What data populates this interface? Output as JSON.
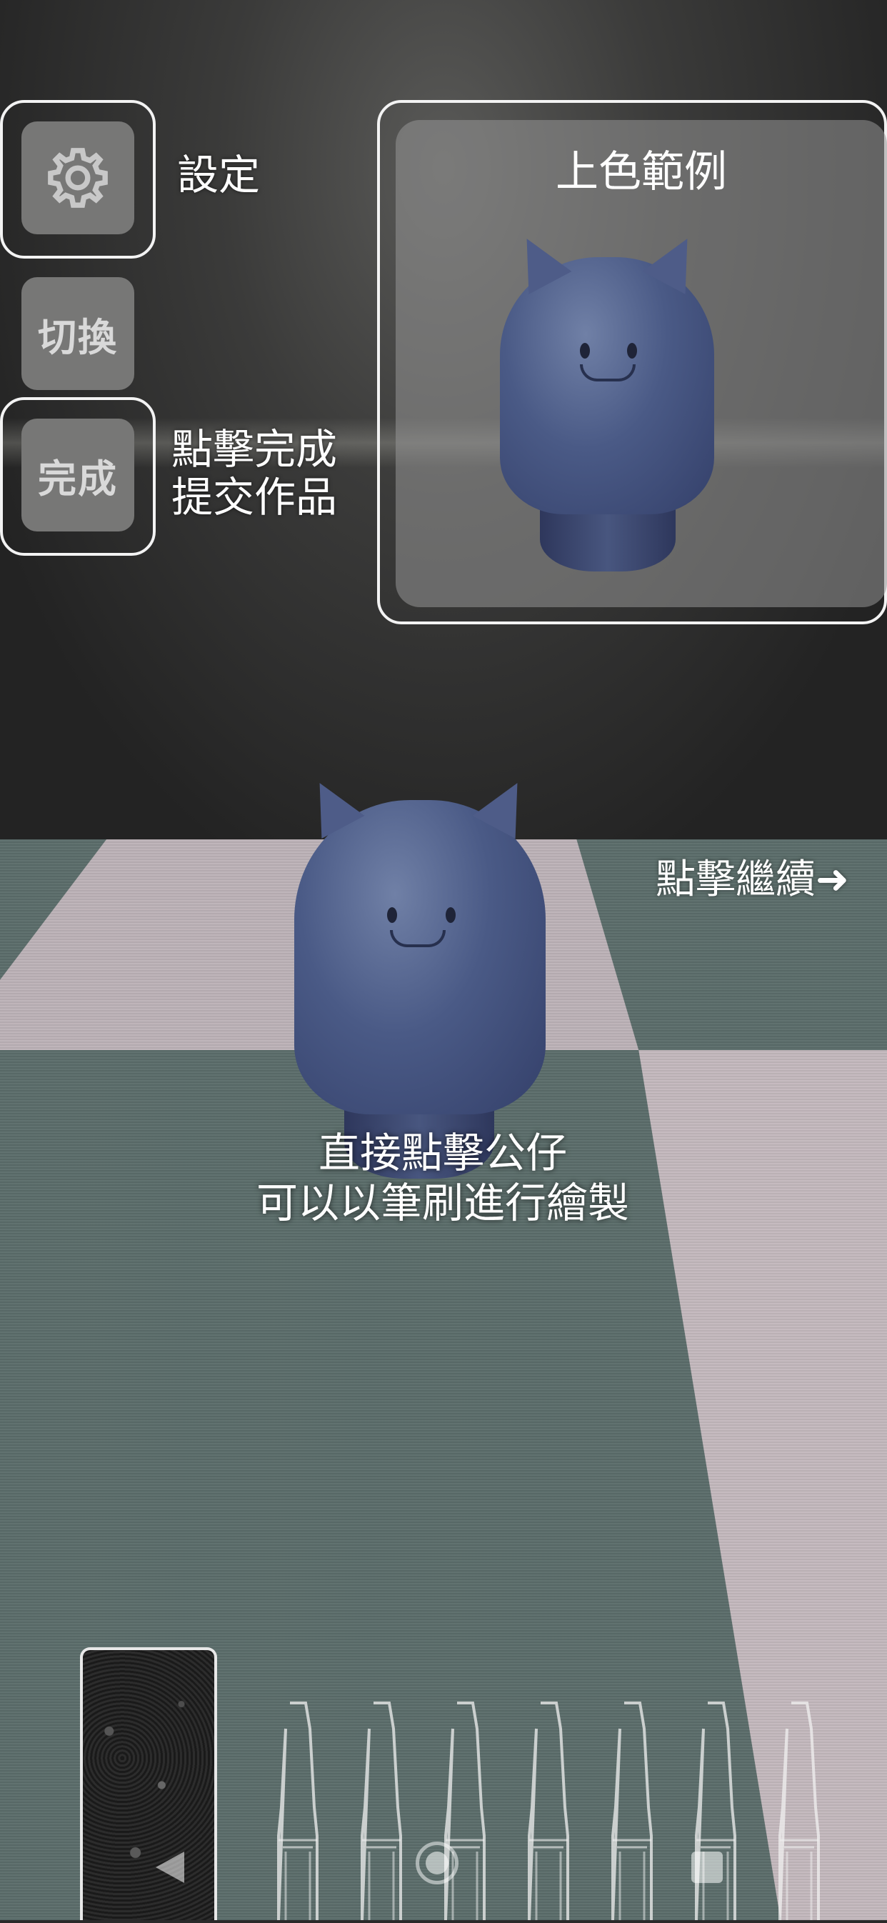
{
  "buttons": {
    "settings_label": "設定",
    "switch_label": "切換",
    "done_label": "完成",
    "done_hint": [
      "點擊完成",
      "提交作品"
    ]
  },
  "example_panel": {
    "title": "上色範例"
  },
  "continue_hint": "點擊繼續➜",
  "instruction": [
    "直接點擊公仔",
    "可以以筆刷進行繪製"
  ],
  "palette": {
    "brush_count": 7
  },
  "icons": {
    "settings": "gear-icon",
    "back": "nav-back-icon",
    "home": "nav-home-icon",
    "recents": "nav-recents-icon"
  }
}
